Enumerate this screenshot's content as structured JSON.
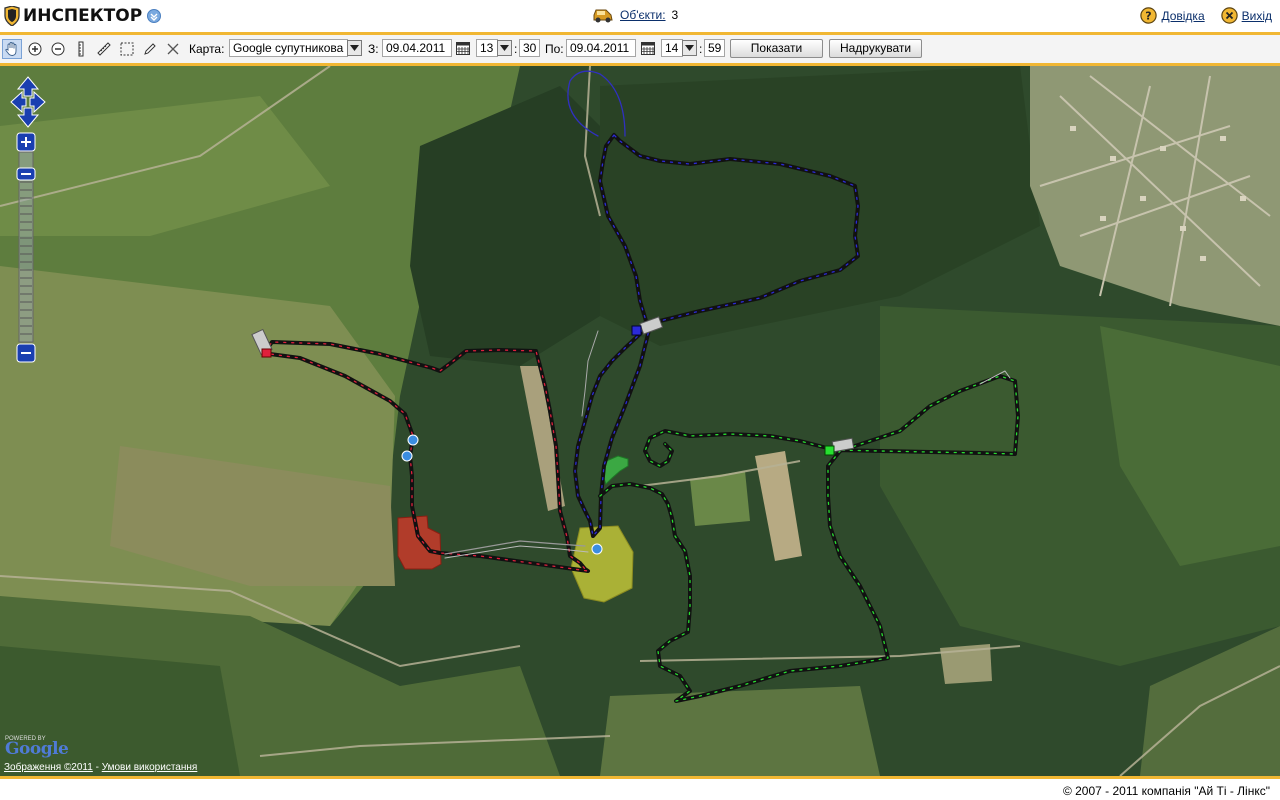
{
  "header": {
    "logo_text": "ИНСПЕКТОР",
    "objects_label": "Об'єкти:",
    "objects_count": "3",
    "help_label": "Довідка",
    "exit_label": "Вихід"
  },
  "toolbar": {
    "tools": [
      "hand-icon",
      "zoom-in-icon",
      "zoom-out-icon",
      "ruler-vertical-icon",
      "ruler-icon",
      "rectangle-select-icon",
      "pencil-icon",
      "clear-icon"
    ],
    "map_label": "Карта:",
    "map_type": "Google супутникова",
    "from_label": "З:",
    "from_date": "09.04.2011",
    "from_hour": "13",
    "from_minute": "30",
    "to_label": "По:",
    "to_date": "09.04.2011",
    "to_hour": "14",
    "to_minute": "59",
    "show_button": "Показати",
    "print_button": "Надрукувати",
    "time_separator": ":"
  },
  "map": {
    "powered_by": "POWERED BY",
    "google_logo": "Google",
    "imagery_credit": "Зображення ©2011",
    "separator": " - ",
    "terms_link": "Умови використання",
    "track_colors": {
      "red": "#e0203c",
      "blue": "#2b2bd8",
      "green": "#27e030"
    },
    "zone_colors": {
      "red_zone": "#c83a2a",
      "yellow_zone": "#d4d43a",
      "green_zone": "#3fbf4a"
    }
  },
  "footer": {
    "copyright": "© 2007 - 2011 компанія \"Ай Ті - Лінкс\""
  },
  "colors": {
    "accent": "#f1b733",
    "link": "#0b2f6b"
  }
}
